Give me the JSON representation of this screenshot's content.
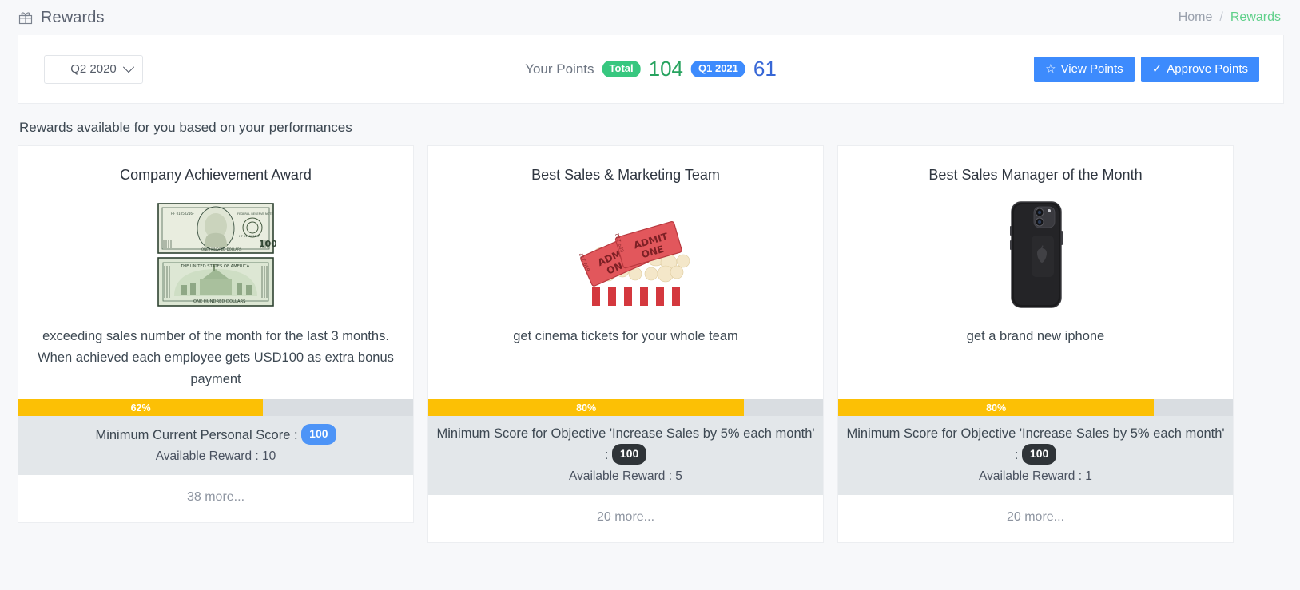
{
  "header": {
    "icon": "gift-icon",
    "title": "Rewards",
    "breadcrumb": {
      "home": "Home",
      "separator": "/",
      "current": "Rewards"
    }
  },
  "toolbar": {
    "period_select": {
      "value": "Q2 2020",
      "icon": "chevron-down-icon"
    },
    "points": {
      "label": "Your Points",
      "total_badge": "Total",
      "total_value": "104",
      "period_badge": "Q1 2021",
      "period_value": "61",
      "total_color": "#27a35f",
      "period_color": "#3767d6"
    },
    "view_points_button": {
      "label": "View Points",
      "icon": "star-icon"
    },
    "approve_points_button": {
      "label": "Approve Points",
      "icon": "check-icon"
    }
  },
  "section": {
    "subtitle": "Rewards available for you based on your performances"
  },
  "cards": [
    {
      "title": "Company Achievement Award",
      "image": "hundred-dollar-bills-image",
      "description": "exceeding sales number of the month for the last 3 months. When achieved each employee gets USD100 as extra bonus payment",
      "progress_label": "62%",
      "progress_value": 62,
      "score_label": "Minimum Current Personal Score :",
      "score_badge": "100",
      "score_badge_color": "#4d94f7",
      "reward_line": "Available Reward : 10",
      "footer": "38 more..."
    },
    {
      "title": "Best Sales & Marketing Team",
      "image": "cinema-tickets-popcorn-image",
      "description": "get cinema tickets for your whole team",
      "progress_label": "80%",
      "progress_value": 80,
      "score_label": "Minimum Score for Objective 'Increase Sales by 5% each month' :",
      "score_badge": "100",
      "score_badge_color": "#2f3438",
      "reward_line": "Available Reward : 5",
      "footer": "20 more..."
    },
    {
      "title": "Best Sales Manager of the Month",
      "image": "black-iphone-image",
      "description": "get a brand new iphone",
      "progress_label": "80%",
      "progress_value": 80,
      "score_label": "Minimum Score for Objective 'Increase Sales by 5% each month' :",
      "score_badge": "100",
      "score_badge_color": "#2f3438",
      "reward_line": "Available Reward : 1",
      "footer": "20 more..."
    }
  ],
  "colors": {
    "accent_blue": "#3d8bfd",
    "progress_amber": "#fcc005",
    "breadcrumb_green": "#5fd08a",
    "panel_gray": "#e3e7ea"
  }
}
